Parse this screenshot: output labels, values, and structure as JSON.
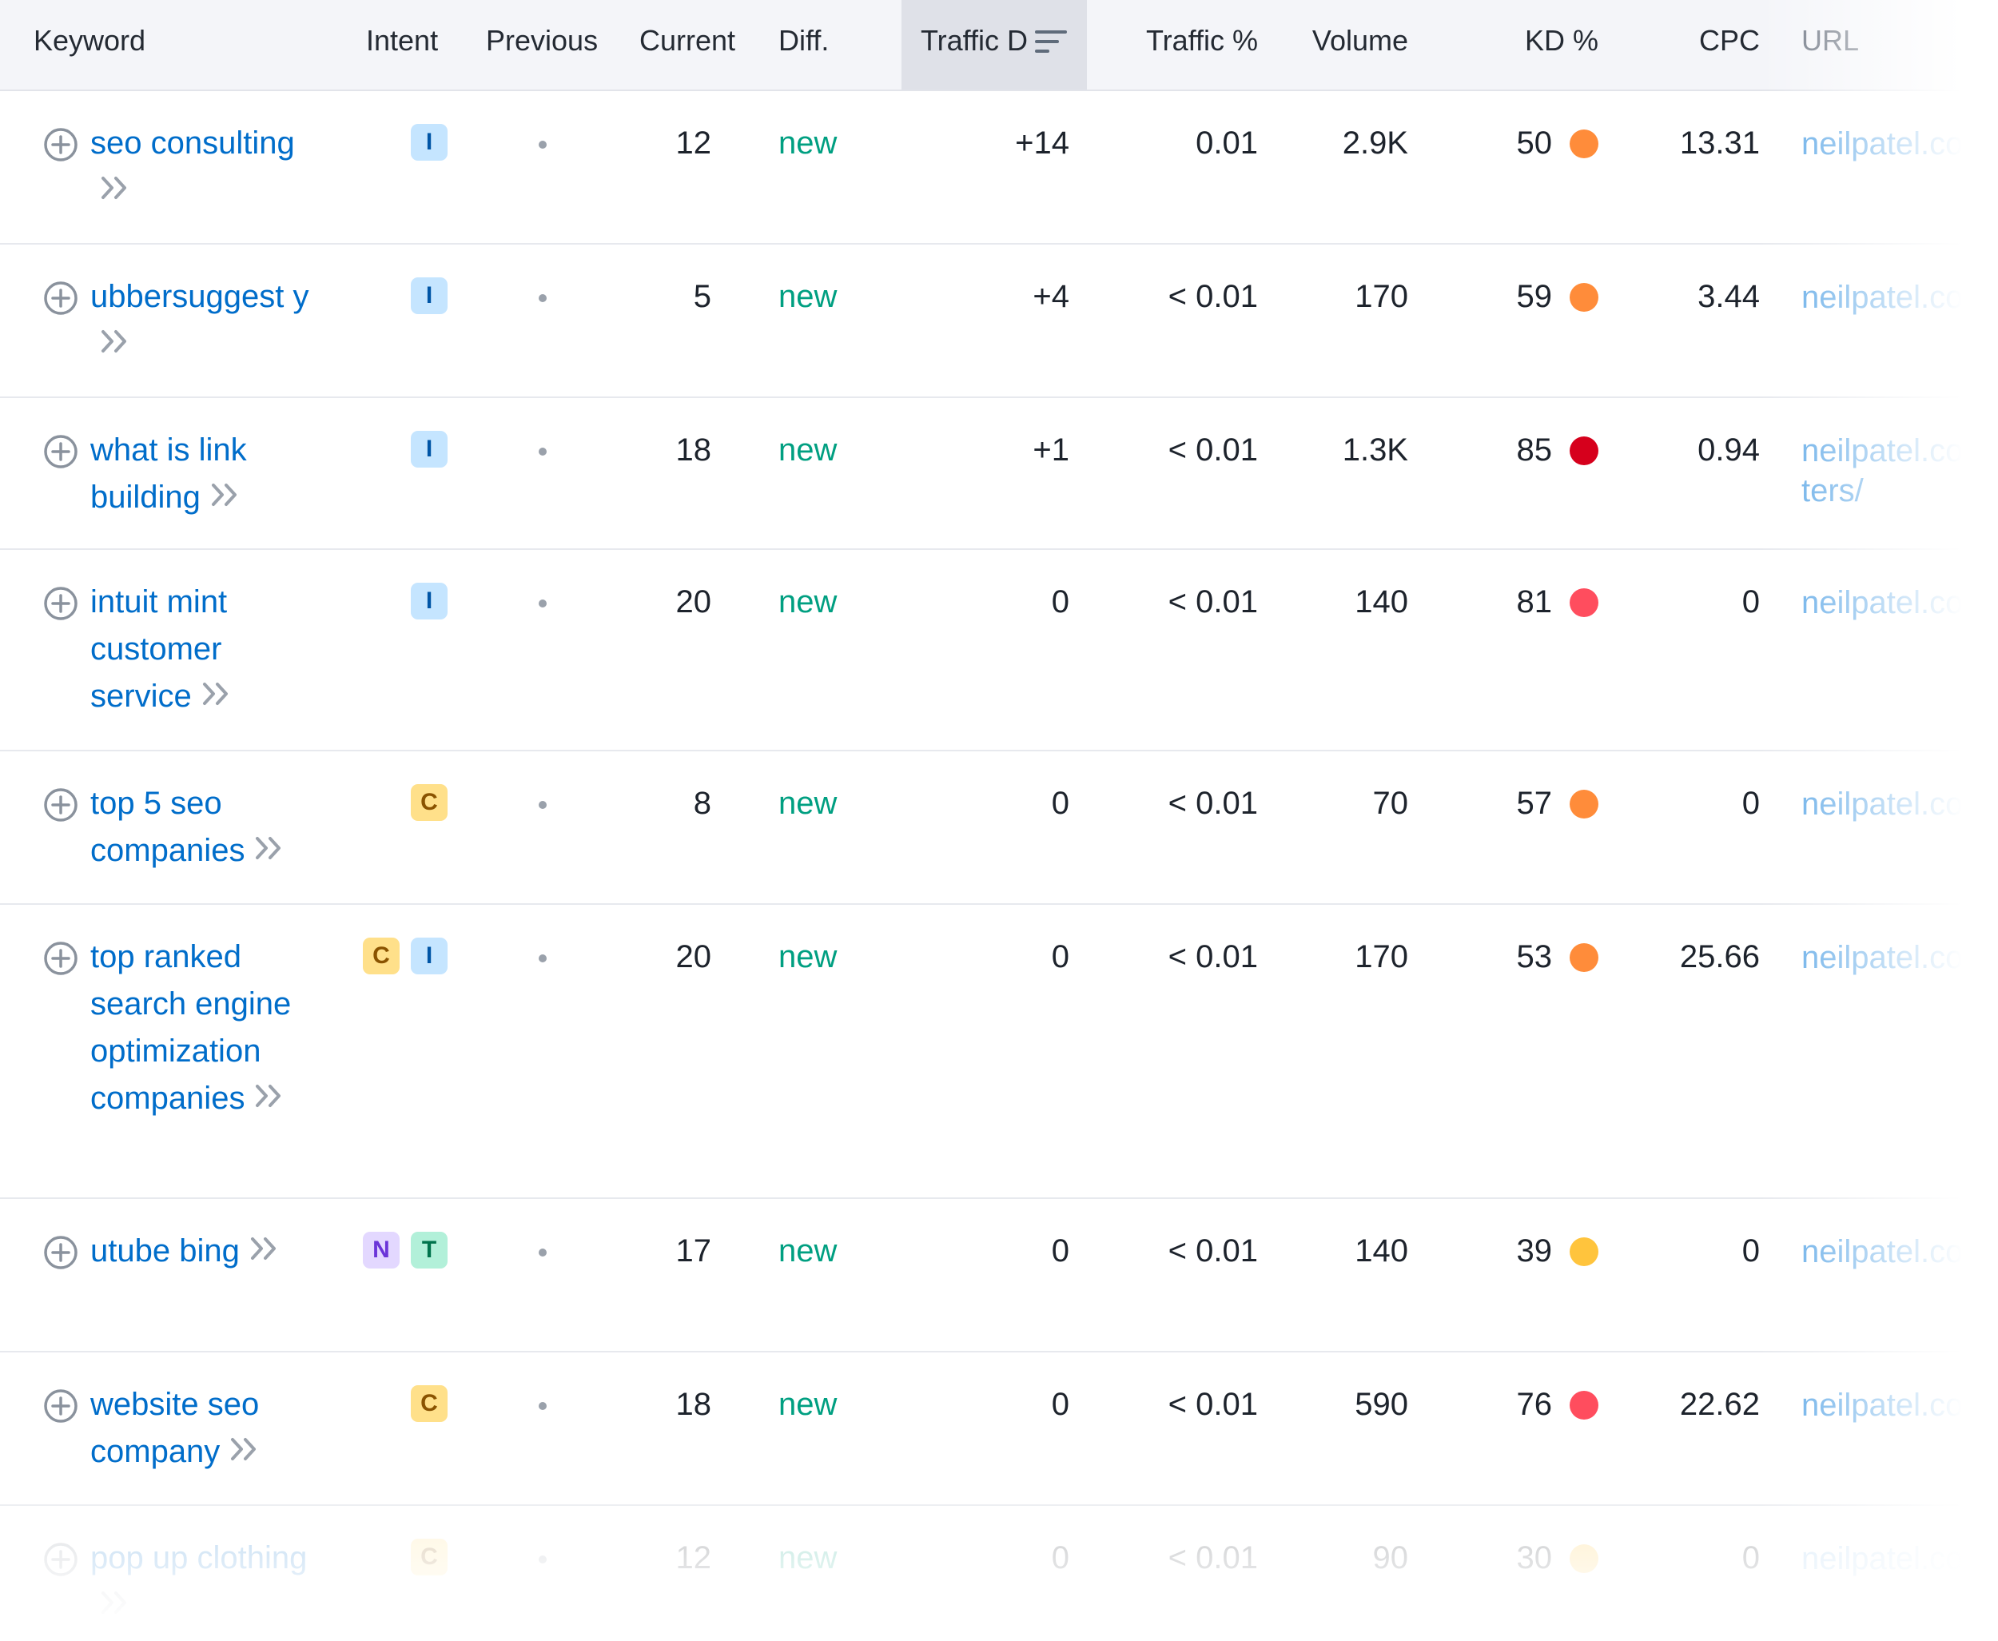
{
  "header": {
    "keyword": "Keyword",
    "intent": "Intent",
    "previous": "Previous",
    "current": "Current",
    "diff": "Diff.",
    "traffic_diff": "Traffic D",
    "traffic_pct": "Traffic %",
    "volume": "Volume",
    "kd": "KD %",
    "cpc": "CPC",
    "url": "URL"
  },
  "colors": {
    "kd_light_orange": "#ff8c3a",
    "kd_red_dark": "#d6001c",
    "kd_red": "#ff4d5e",
    "kd_yellow": "#ffc43d",
    "keyword_link": "#006dca",
    "diff_new": "#009f81"
  },
  "rows": [
    {
      "keyword": "seo consulting",
      "intents": [
        "I"
      ],
      "previous": "•",
      "current": "12",
      "diff": "new",
      "traffic_diff": "+14",
      "traffic_pct": "0.01",
      "volume": "2.9K",
      "kd": "50",
      "kd_color": "#ff8c3a",
      "cpc": "13.31",
      "url": "neilpatel.com"
    },
    {
      "keyword": "ubbersuggest y",
      "intents": [
        "I"
      ],
      "previous": "•",
      "current": "5",
      "diff": "new",
      "traffic_diff": "+4",
      "traffic_pct": "< 0.01",
      "volume": "170",
      "kd": "59",
      "kd_color": "#ff8c3a",
      "cpc": "3.44",
      "url": "neilpatel.com"
    },
    {
      "keyword": "what is link building",
      "intents": [
        "I"
      ],
      "previous": "•",
      "current": "18",
      "diff": "new",
      "traffic_diff": "+1",
      "traffic_pct": "< 0.01",
      "volume": "1.3K",
      "kd": "85",
      "kd_color": "#d6001c",
      "cpc": "0.94",
      "url": "neilpatel.com ters/"
    },
    {
      "keyword": "intuit mint customer service",
      "intents": [
        "I"
      ],
      "previous": "•",
      "current": "20",
      "diff": "new",
      "traffic_diff": "0",
      "traffic_pct": "< 0.01",
      "volume": "140",
      "kd": "81",
      "kd_color": "#ff4d5e",
      "cpc": "0",
      "url": "neilpatel.com"
    },
    {
      "keyword": "top 5 seo companies",
      "intents": [
        "C"
      ],
      "previous": "•",
      "current": "8",
      "diff": "new",
      "traffic_diff": "0",
      "traffic_pct": "< 0.01",
      "volume": "70",
      "kd": "57",
      "kd_color": "#ff8c3a",
      "cpc": "0",
      "url": "neilpatel.com"
    },
    {
      "keyword": "top ranked search engine optimization companies",
      "intents": [
        "C",
        "I"
      ],
      "previous": "•",
      "current": "20",
      "diff": "new",
      "traffic_diff": "0",
      "traffic_pct": "< 0.01",
      "volume": "170",
      "kd": "53",
      "kd_color": "#ff8c3a",
      "cpc": "25.66",
      "url": "neilpatel.com"
    },
    {
      "keyword": "utube bing",
      "intents": [
        "N",
        "T"
      ],
      "previous": "•",
      "current": "17",
      "diff": "new",
      "traffic_diff": "0",
      "traffic_pct": "< 0.01",
      "volume": "140",
      "kd": "39",
      "kd_color": "#ffc43d",
      "cpc": "0",
      "url": "neilpatel.com"
    },
    {
      "keyword": "website seo company",
      "intents": [
        "C"
      ],
      "previous": "•",
      "current": "18",
      "diff": "new",
      "traffic_diff": "0",
      "traffic_pct": "< 0.01",
      "volume": "590",
      "kd": "76",
      "kd_color": "#ff4d5e",
      "cpc": "22.62",
      "url": "neilpatel.com"
    },
    {
      "keyword": "pop up clothing",
      "intents": [
        "C"
      ],
      "previous": "•",
      "current": "12",
      "diff": "new",
      "traffic_diff": "0",
      "traffic_pct": "< 0.01",
      "volume": "90",
      "kd": "30",
      "kd_color": "#ffc43d",
      "cpc": "0",
      "url": "neilpatel.com"
    }
  ]
}
